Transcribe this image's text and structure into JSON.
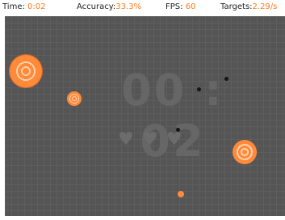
{
  "hud": {
    "time_label": "Time:",
    "time_value": "0:02",
    "accuracy_label": "Accuracy:",
    "accuracy_value": "33.3%",
    "fps_label": "FPS:",
    "fps_value": "60",
    "targets_label": "Targets:",
    "targets_value": "2.29/s"
  },
  "arena": {
    "clock": "00:02",
    "lives_glyph": "♥",
    "lives_count": 3
  },
  "colors": {
    "accent": "#ff7a1f",
    "target_outer": "#ff8a3a",
    "target_ring": "#ffd1ad",
    "arena_bg": "#555555",
    "grid": "#5e5e5e"
  }
}
